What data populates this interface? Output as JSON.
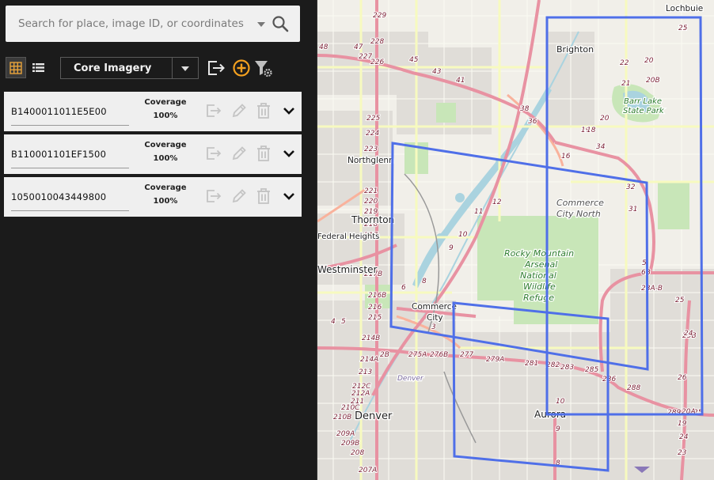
{
  "search": {
    "placeholder": "Search for place, image ID, or coordinates",
    "value": ""
  },
  "toolbar": {
    "layer_select": "Core Imagery"
  },
  "images": [
    {
      "id": "B1400011011E5E00",
      "coverage_label": "Coverage",
      "coverage_value": "100%"
    },
    {
      "id": "B110001101EF1500",
      "coverage_label": "Coverage",
      "coverage_value": "100%"
    },
    {
      "id": "1050010043449800",
      "coverage_label": "Coverage",
      "coverage_value": "100%"
    }
  ],
  "map": {
    "places": [
      "Lochbuie",
      "Brighton",
      "Barr Lake",
      "State Park",
      "Northglenn",
      "Thornton",
      "Commerce",
      "City North",
      "Rocky Mountain",
      "Arsenal",
      "National",
      "Wildlife",
      "Refuge",
      "Federal Heights",
      "Westminster",
      "Commerce",
      "City",
      "Denver",
      "Denver",
      "Aurora"
    ],
    "exits": [
      "229",
      "228",
      "48",
      "47",
      "227",
      "226",
      "45",
      "43",
      "41",
      "38",
      "36",
      "225",
      "224",
      "223",
      "221",
      "220",
      "219",
      "218",
      "217",
      "217B",
      "216B",
      "216",
      "215",
      "214B",
      "214A",
      "213",
      "212C",
      "212A",
      "211",
      "210C",
      "210B",
      "209A",
      "209B",
      "208",
      "207A",
      "22",
      "21",
      "20",
      "19",
      "18",
      "16",
      "34",
      "32",
      "31",
      "12",
      "11",
      "10",
      "9",
      "8",
      "6",
      "5",
      "4",
      "3",
      "2B",
      "275A",
      "276B",
      "277",
      "279A",
      "281",
      "282",
      "283",
      "285",
      "286",
      "288",
      "289",
      "25",
      "22",
      "20",
      "20B",
      "20A",
      "19",
      "24",
      "23",
      "23B",
      "5",
      "6B",
      "28A-B",
      "25",
      "24",
      "26",
      "10",
      "9",
      "8",
      "25"
    ],
    "colors": {
      "background": "#f1efe9",
      "water": "#aad3df",
      "park": "#c8e6b8",
      "highway": "#e892a2",
      "trunk": "#f9b29c",
      "major": "#f7fabf",
      "footprint": "#4f6fe8"
    }
  }
}
